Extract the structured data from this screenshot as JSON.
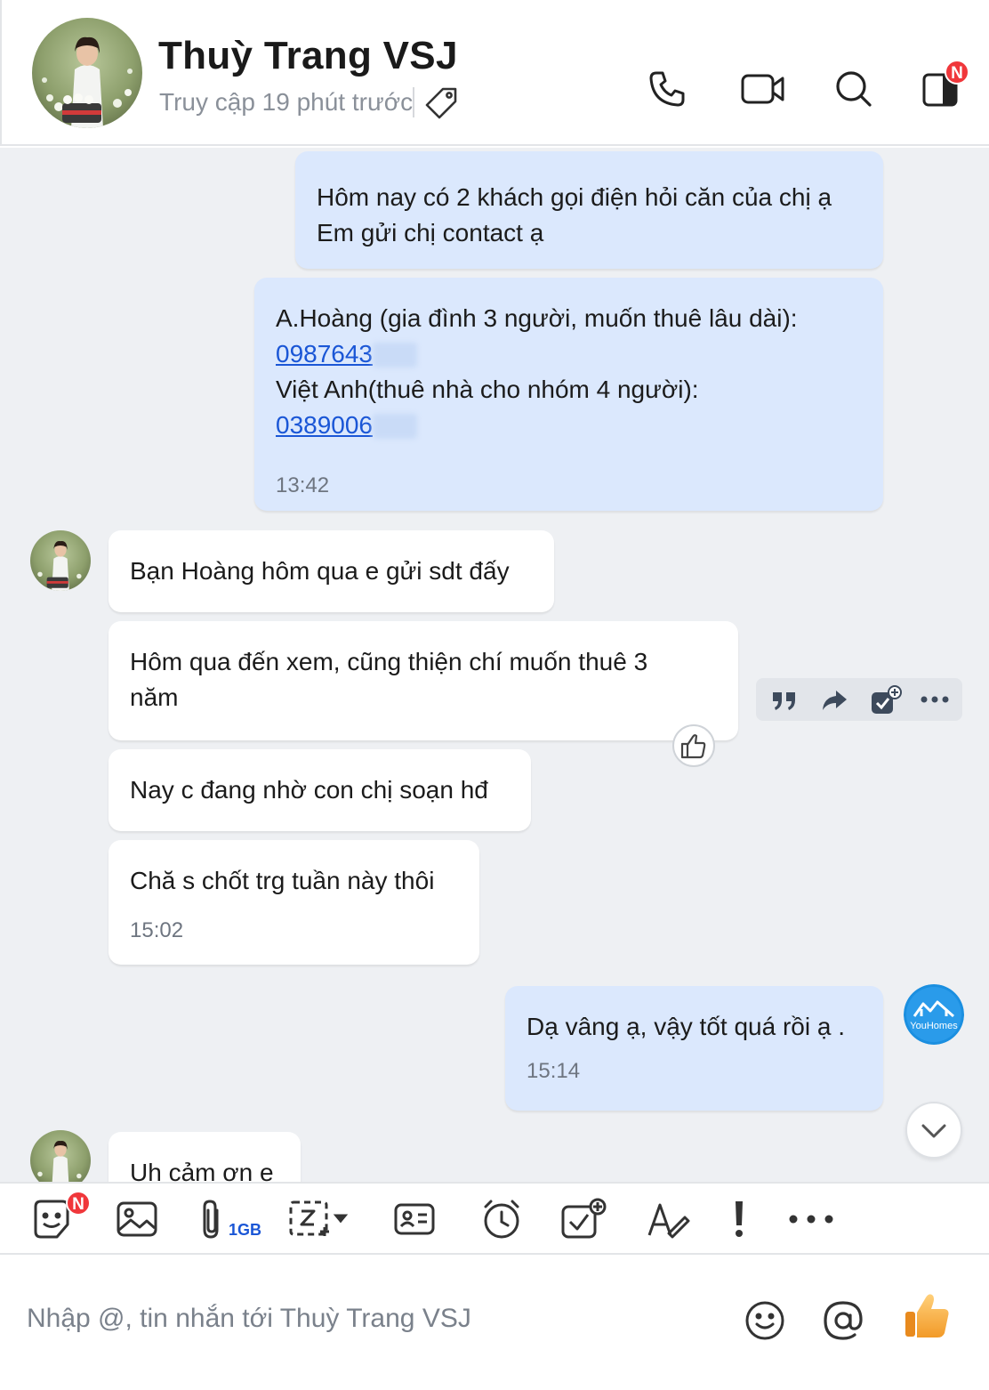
{
  "header": {
    "name": "Thuỳ Trang VSJ",
    "status": "Truy cập 19 phút trước",
    "badge": "N",
    "icons": [
      "tag-icon",
      "phone-icon",
      "video-icon",
      "search-icon",
      "sidebar-toggle-icon"
    ]
  },
  "messages": [
    {
      "side": "out",
      "lines": [
        "Hôm nay có 2 khách gọi điện hỏi căn của chị ạ",
        "Em gửi chị contact ạ"
      ]
    },
    {
      "side": "out",
      "line1": "A.Hoàng (gia đình 3 người, muốn thuê lâu dài):",
      "phone1": "0987643",
      "line3": "Việt Anh(thuê nhà cho nhóm 4 người):",
      "phone2": "0389006",
      "time": "13:42"
    },
    {
      "side": "in",
      "text": "Bạn Hoàng hôm qua e gửi sdt đấy"
    },
    {
      "side": "in",
      "lines": [
        "Hôm qua đến xem, cũng thiện chí muốn thuê 3",
        "năm"
      ]
    },
    {
      "side": "in",
      "text": "Nay c đang nhờ con chị soạn hđ"
    },
    {
      "side": "in",
      "text": "Chă s chốt trg tuần này thôi",
      "time": "15:02"
    },
    {
      "side": "out",
      "text": "Dạ vâng ạ, vậy tốt quá rồi ạ .",
      "time": "15:14"
    },
    {
      "side": "in",
      "text": "Uh cảm ơn e"
    }
  ],
  "sender_logo_text": "YouHomes",
  "message_actions": [
    "quote-icon",
    "forward-icon",
    "add-task-icon",
    "more-icon"
  ],
  "toolbar": {
    "sticker_badge": "N",
    "file_limit": "1GB",
    "icons": [
      "sticker-icon",
      "image-icon",
      "attach-icon",
      "screenshot-icon",
      "contact-card-icon",
      "reminder-icon",
      "todo-icon",
      "text-format-icon",
      "urgent-icon",
      "more-icon"
    ]
  },
  "composer": {
    "placeholder": "Nhập @, tin nhắn tới Thuỳ Trang VSJ",
    "icons": [
      "emoji-icon",
      "mention-icon",
      "thumbs-up-icon"
    ]
  },
  "colors": {
    "outgoing": "#dbe8fd",
    "incoming": "#ffffff",
    "background": "#eef0f3",
    "link": "#1a56d6",
    "badge": "#f0373b"
  }
}
